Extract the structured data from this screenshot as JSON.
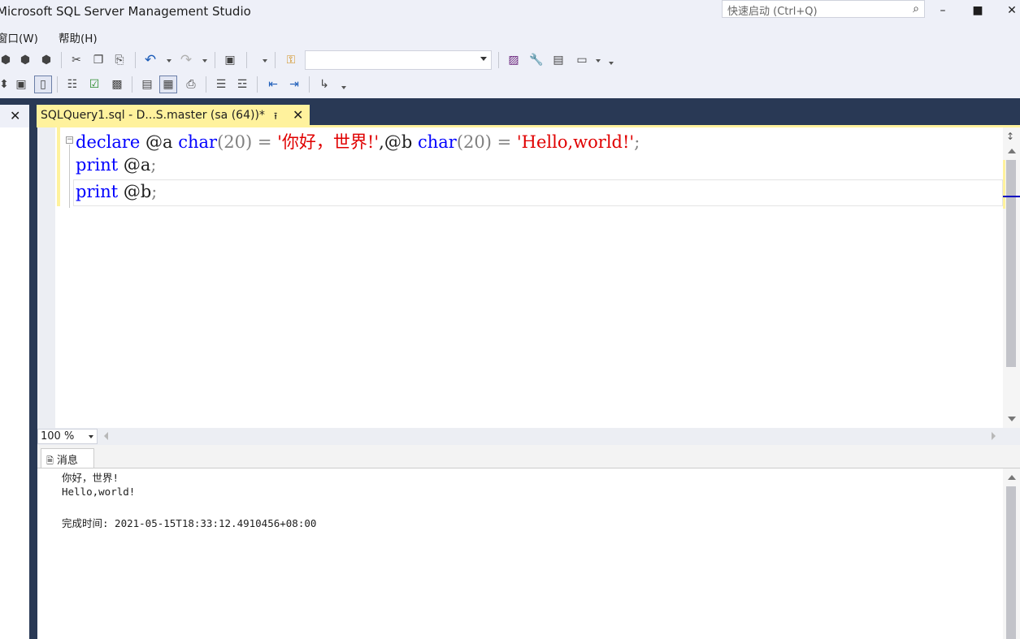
{
  "window": {
    "title": "Microsoft SQL Server Management Studio",
    "quick_launch_placeholder": "快速启动 (Ctrl+Q)"
  },
  "menu": {
    "items": [
      "窗口(W)",
      "帮助(H)"
    ]
  },
  "toolbar": {
    "db_selector_value": ""
  },
  "document_tab": {
    "label": "SQLQuery1.sql - D...S.master (sa (64))*"
  },
  "editor": {
    "lines": [
      [
        {
          "t": "declare",
          "c": "kw"
        },
        {
          "t": " @a ",
          "c": ""
        },
        {
          "t": "char",
          "c": "kw"
        },
        {
          "t": "(20) ",
          "c": "op"
        },
        {
          "t": "= ",
          "c": "op"
        },
        {
          "t": "'你好，世界!'",
          "c": "str"
        },
        {
          "t": ",@b ",
          "c": ""
        },
        {
          "t": "char",
          "c": "kw"
        },
        {
          "t": "(20) ",
          "c": "op"
        },
        {
          "t": "= ",
          "c": "op"
        },
        {
          "t": "'Hello,world!'",
          "c": "str"
        },
        {
          "t": ";",
          "c": "op"
        }
      ],
      [
        {
          "t": "print",
          "c": "kw"
        },
        {
          "t": " @a",
          "c": ""
        },
        {
          "t": ";",
          "c": "op"
        }
      ],
      [
        {
          "t": "print",
          "c": "kw"
        },
        {
          "t": " @b",
          "c": ""
        },
        {
          "t": ";",
          "c": "op"
        }
      ]
    ]
  },
  "zoom": {
    "value": "100 %"
  },
  "results": {
    "tab_label": "消息",
    "messages": [
      "你好，世界!",
      "Hello,world!",
      "",
      "完成时间: 2021-05-15T18:33:12.4910456+08:00"
    ]
  }
}
